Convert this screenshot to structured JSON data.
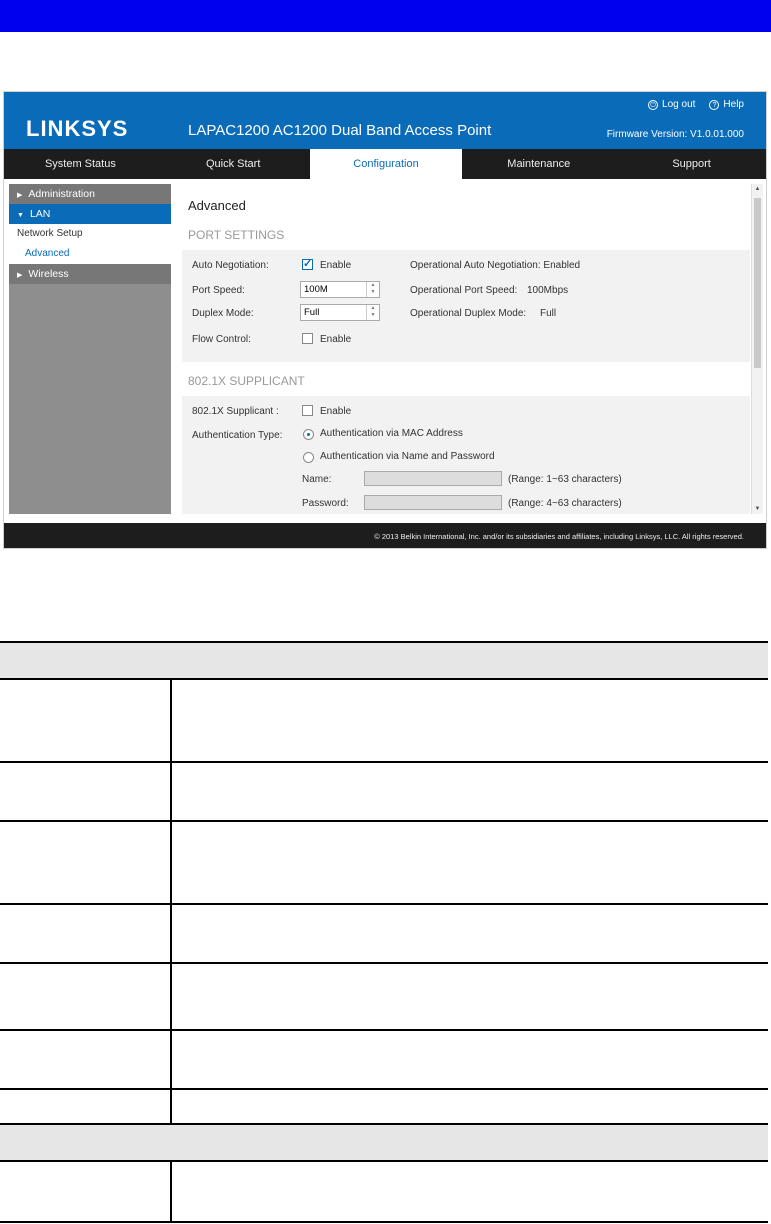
{
  "header": {
    "brand": "LINKSYS",
    "product_title": "LAPAC1200 AC1200 Dual Band Access Point",
    "logout": "Log out",
    "help": "Help",
    "firmware": "Firmware Version: V1.0.01.000"
  },
  "nav": {
    "tabs": [
      "System Status",
      "Quick Start",
      "Configuration",
      "Maintenance",
      "Support"
    ],
    "active": "Configuration"
  },
  "sidebar": {
    "administration": "Administration",
    "lan": "LAN",
    "network_setup": "Network Setup",
    "advanced": "Advanced",
    "wireless": "Wireless"
  },
  "page": {
    "title": "Advanced",
    "port_settings": {
      "heading": "PORT SETTINGS",
      "auto_neg_label": "Auto Negotiation:",
      "auto_neg_enable": "Enable",
      "op_auto_neg": "Operational Auto Negotiation: Enabled",
      "port_speed_label": "Port Speed:",
      "port_speed_value": "100M",
      "op_port_speed_label": "Operational Port Speed:",
      "op_port_speed_value": "100Mbps",
      "duplex_label": "Duplex Mode:",
      "duplex_value": "Full",
      "op_duplex_label": "Operational Duplex Mode:",
      "op_duplex_value": "Full",
      "flow_label": "Flow Control:",
      "flow_enable": "Enable"
    },
    "supplicant": {
      "heading": "802.1X SUPPLICANT",
      "supp_label": "802.1X Supplicant :",
      "supp_enable": "Enable",
      "auth_label": "Authentication Type:",
      "auth_mac": "Authentication via MAC Address",
      "auth_name": "Authentication via Name and Password",
      "name_label": "Name:",
      "name_range": "(Range: 1~63 characters)",
      "password_label": "Password:",
      "password_range": "(Range: 4~63 characters)"
    }
  },
  "footer": "© 2013 Belkin International, Inc. and/or its subsidiaries and affiliates, including Linksys, LLC. All rights reserved.",
  "colors": {
    "top_bar": "#0000ee",
    "brand_blue": "#0a6bb8",
    "nav_dark": "#1d1d1d"
  }
}
